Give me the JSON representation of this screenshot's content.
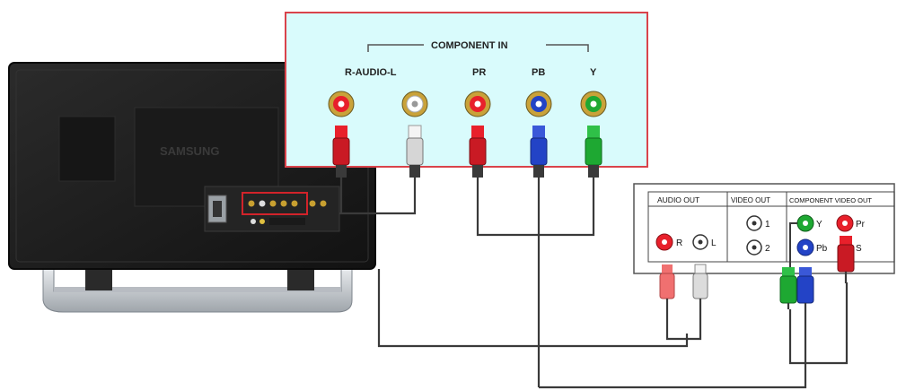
{
  "monitor": {
    "brand": "SAMSUNG",
    "colors": {
      "body": "#1c1c1c",
      "stand": "#c8ccd0",
      "highlight": "#d2232a"
    }
  },
  "component_in_panel": {
    "title": "COMPONENT IN",
    "background": "#d9fbfc",
    "border": "#d9434b",
    "jacks": [
      {
        "label": "R-AUDIO-L",
        "color": "#e8202b"
      },
      {
        "label": "",
        "color": "#ffffff"
      },
      {
        "label": "PR",
        "color": "#e8202b"
      },
      {
        "label": "PB",
        "color": "#2343c6"
      },
      {
        "label": "Y",
        "color": "#1ea832"
      }
    ]
  },
  "source_device": {
    "audio_out": {
      "title": "AUDIO OUT",
      "left_label": "R",
      "right_label": "L"
    },
    "video_out": {
      "title": "VIDEO OUT",
      "ports": [
        "1",
        "2"
      ]
    },
    "component_video_out": {
      "title": "COMPONENT VIDEO OUT",
      "ports": [
        {
          "label": "Y",
          "color": "#1ea832"
        },
        {
          "label": "Pr",
          "color": "#e8202b"
        },
        {
          "label": "Pb",
          "color": "#2343c6"
        },
        {
          "label": "S",
          "color": "#e8202b"
        }
      ]
    }
  },
  "plug_colors": {
    "red": "#e8202b",
    "white": "#e6e6e6",
    "blue": "#2343c6",
    "green": "#1ea832",
    "pink": "#f07070"
  }
}
